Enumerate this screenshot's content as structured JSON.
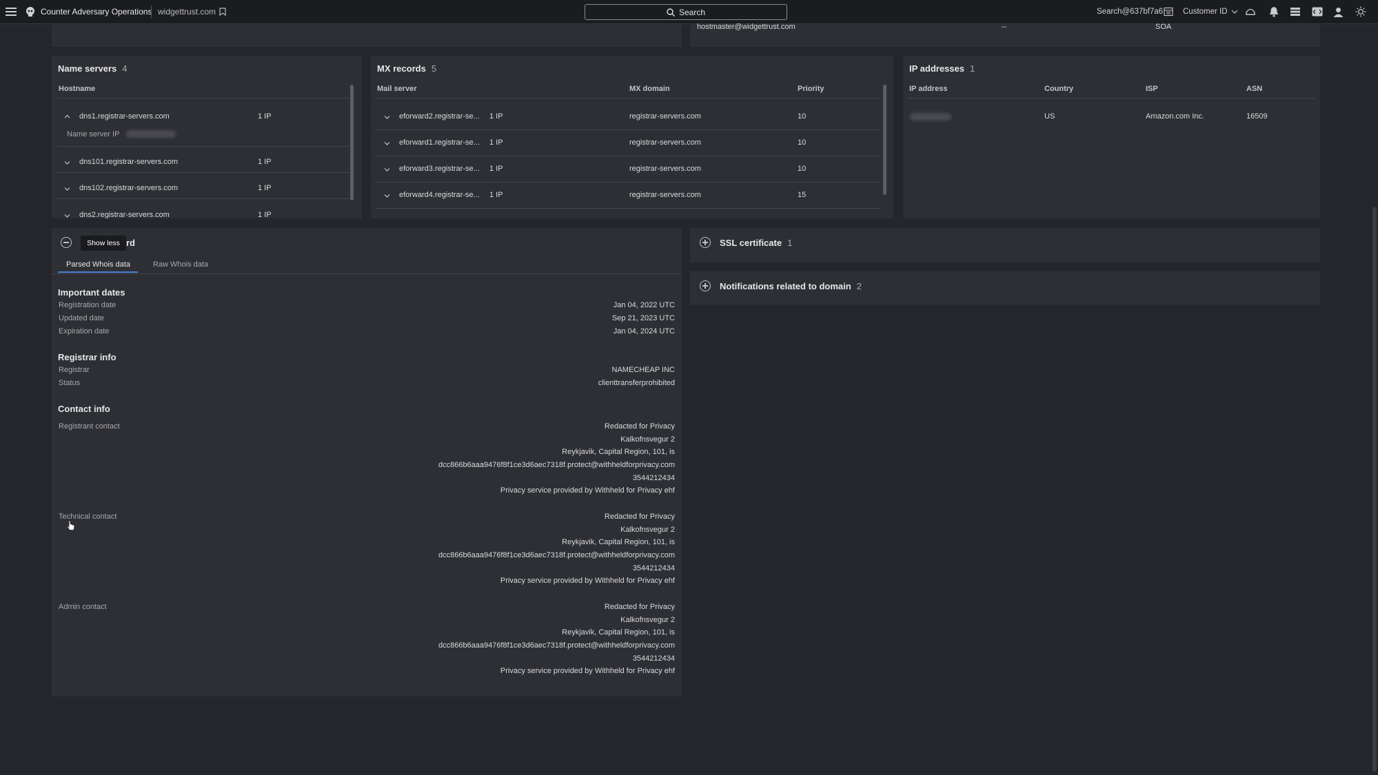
{
  "topbar": {
    "app_title": "Counter Adversary Operations",
    "domain": "widgettrust.com",
    "search_label": "Search",
    "account": "Search@637bf7a6",
    "customer_label": "Customer ID"
  },
  "soa_partial": {
    "email": "hostmaster@widgettrust.com",
    "dash": "--",
    "type": "SOA"
  },
  "name_servers": {
    "title": "Name servers",
    "count": "4",
    "col_hostname": "Hostname",
    "rows": [
      {
        "hostname": "dns1.registrar-servers.com",
        "ips": "1 IP"
      },
      {
        "hostname": "dns101.registrar-servers.com",
        "ips": "1 IP"
      },
      {
        "hostname": "dns102.registrar-servers.com",
        "ips": "1 IP"
      },
      {
        "hostname": "dns2.registrar-servers.com",
        "ips": "1 IP"
      }
    ],
    "expanded_label": "Name server IP"
  },
  "mx_records": {
    "title": "MX records",
    "count": "5",
    "col_mail_server": "Mail server",
    "col_mx_domain": "MX domain",
    "col_priority": "Priority",
    "rows": [
      {
        "server": "eforward2.registrar-se...",
        "ips": "1 IP",
        "domain": "registrar-servers.com",
        "priority": "10"
      },
      {
        "server": "eforward1.registrar-se...",
        "ips": "1 IP",
        "domain": "registrar-servers.com",
        "priority": "10"
      },
      {
        "server": "eforward3.registrar-se...",
        "ips": "1 IP",
        "domain": "registrar-servers.com",
        "priority": "10"
      },
      {
        "server": "eforward4.registrar-se...",
        "ips": "1 IP",
        "domain": "registrar-servers.com",
        "priority": "15"
      }
    ]
  },
  "ip_addresses": {
    "title": "IP addresses",
    "count": "1",
    "col_ip": "IP address",
    "col_country": "Country",
    "col_isp": "ISP",
    "col_asn": "ASN",
    "rows": [
      {
        "country": "US",
        "isp": "Amazon.com Inc.",
        "asn": "16509"
      }
    ]
  },
  "whois": {
    "title_suffix": "rd",
    "tooltip": "Show less",
    "tabs": [
      "Parsed Whois data",
      "Raw Whois data"
    ],
    "important_dates": {
      "heading": "Important dates",
      "registration_label": "Registration date",
      "registration_value": "Jan 04, 2022 UTC",
      "updated_label": "Updated date",
      "updated_value": "Sep 21, 2023 UTC",
      "expiration_label": "Expiration date",
      "expiration_value": "Jan 04, 2024 UTC"
    },
    "registrar_info": {
      "heading": "Registrar info",
      "registrar_label": "Registrar",
      "registrar_value": "NAMECHEAP INC",
      "status_label": "Status",
      "status_value": "clienttransferprohibited"
    },
    "contact_info": {
      "heading": "Contact info",
      "contacts": [
        {
          "label": "Registrant contact",
          "lines": [
            "Redacted for Privacy",
            "Kalkofnsvegur 2",
            "Reykjavik, Capital Region, 101, is",
            "dcc866b6aaa9476f8f1ce3d6aec7318f.protect@withheldforprivacy.com",
            "3544212434",
            "Privacy service provided by Withheld for Privacy ehf"
          ]
        },
        {
          "label": "Technical contact",
          "lines": [
            "Redacted for Privacy",
            "Kalkofnsvegur 2",
            "Reykjavik, Capital Region, 101, is",
            "dcc866b6aaa9476f8f1ce3d6aec7318f.protect@withheldforprivacy.com",
            "3544212434",
            "Privacy service provided by Withheld for Privacy ehf"
          ]
        },
        {
          "label": "Admin contact",
          "lines": [
            "Redacted for Privacy",
            "Kalkofnsvegur 2",
            "Reykjavik, Capital Region, 101, is",
            "dcc866b6aaa9476f8f1ce3d6aec7318f.protect@withheldforprivacy.com",
            "3544212434",
            "Privacy service provided by Withheld for Privacy ehf"
          ]
        }
      ]
    }
  },
  "ssl": {
    "title": "SSL certificate",
    "count": "1"
  },
  "notifications": {
    "title": "Notifications related to domain",
    "count": "2"
  },
  "colors": {
    "background": "#25262b",
    "panel": "#2e2f34",
    "topbar": "#1b1c1f",
    "accent": "#4a7fd4"
  }
}
